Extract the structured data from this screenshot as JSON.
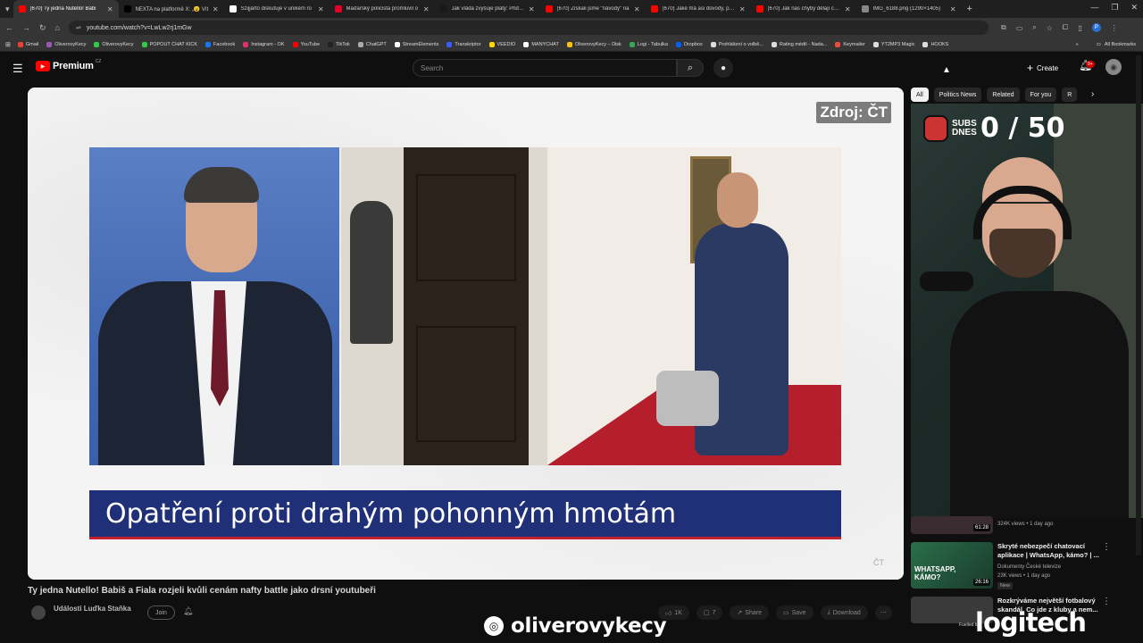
{
  "browser": {
    "tabs": [
      {
        "title": "(670) Ty jedna Nutello! Babi",
        "color": "#ff0000",
        "active": true
      },
      {
        "title": "NEXTA na platformě X: „😮 Vít",
        "color": "#000000",
        "active": false
      },
      {
        "title": "Szijjártó diskutuje v unikém ro",
        "color": "#ffffff",
        "active": false
      },
      {
        "title": "Maďarský policista promluvil o",
        "color": "#e4002b",
        "active": false
      },
      {
        "title": "Jak vláda zvyšuje platy: Přidá lé",
        "color": "#1a1a1a",
        "active": false
      },
      {
        "title": "(670) Získali jsme \"návody\" na",
        "color": "#ff0000",
        "active": false
      },
      {
        "title": "(670) Jaké má asi důvody, proč",
        "color": "#ff0000",
        "active": false
      },
      {
        "title": "(670) Jak nás chyby dělají chytř",
        "color": "#ff0000",
        "active": false
      },
      {
        "title": "IMG_6188.png (1290×1405)",
        "color": "#888888",
        "active": false
      }
    ],
    "url": "youtube.com/watch?v=LwLw2rj1mGw",
    "profile_initial": "P",
    "bookmarks": [
      {
        "label": "Gmail",
        "color": "#ea4335"
      },
      {
        "label": "OliverovyKecy",
        "color": "#9b59b6"
      },
      {
        "label": "OliverovyKecy",
        "color": "#2ecc40"
      },
      {
        "label": "POPOUT CHAT KICK",
        "color": "#2ecc40"
      },
      {
        "label": "Facebook",
        "color": "#1877f2"
      },
      {
        "label": "Instagram - OK",
        "color": "#e1306c"
      },
      {
        "label": "YouTube",
        "color": "#ff0000"
      },
      {
        "label": "TikTok",
        "color": "#222222"
      },
      {
        "label": "ChatGPT",
        "color": "#aaaaaa"
      },
      {
        "label": "StreamElements",
        "color": "#ffffff"
      },
      {
        "label": "Transkriptor",
        "color": "#3d5afe"
      },
      {
        "label": "VEEDIO",
        "color": "#ffd600"
      },
      {
        "label": "MANYCHAT",
        "color": "#ffffff"
      },
      {
        "label": "OliverovyKecy – Disk",
        "color": "#ffc107"
      },
      {
        "label": "Logi - Tabulka",
        "color": "#34a853"
      },
      {
        "label": "Dropbox",
        "color": "#0061ff"
      },
      {
        "label": "Prohlášení o volbě...",
        "color": "#dddddd"
      },
      {
        "label": "Rating médií - Nada...",
        "color": "#dddddd"
      },
      {
        "label": "Keymailer",
        "color": "#e74c3c"
      },
      {
        "label": "YT2MP3 Magic",
        "color": "#dddddd"
      },
      {
        "label": "HOOKS",
        "color": "#dddddd"
      }
    ],
    "all_bookmarks": "All Bookmarks"
  },
  "youtube": {
    "logo_text": "Premium",
    "country": "CZ",
    "search_placeholder": "Search",
    "create_label": "Create",
    "notif_badge": "9+",
    "filter_chips": [
      "All",
      "Politics News",
      "Related",
      "For you",
      "R"
    ],
    "video": {
      "source_tag": "Zdroj: ČT",
      "lower_third": "Opatření proti drahým pohonným hmotám",
      "title": "Ty jedna Nutello! Babiš a Fiala rozjeli kvůli cenám nafty battle jako drsní youtubeři",
      "channel": "Události Luďka Staňka",
      "join_label": "Join",
      "likes": "1K",
      "comments": "7",
      "share_label": "Share",
      "save_label": "Save",
      "download_label": "Download"
    },
    "stream_overlay": {
      "subs_label": "SUBS DNES",
      "subs_count": "0 / 50"
    },
    "related": [
      {
        "title": "",
        "meta": "324K views • 1 day ago",
        "duration": "61:28",
        "new": false
      },
      {
        "title": "Skryté nebezpečí chatovací aplikace | WhatsApp, kámo? | ...",
        "channel": "Dokumenty České televize",
        "meta": "23K views • 1 day ago",
        "duration": "26:16",
        "new": "New",
        "thumb_text": "WHATSAPP, KÁMO?"
      },
      {
        "title": "Rozkrýváme největší fotbalový skandál. Co jde z kluby a nem...",
        "meta": "",
        "duration": "",
        "new": false
      }
    ]
  },
  "watermark": {
    "handle": "oliverovykecy",
    "sponsor": "logitech",
    "sponsor_pre": "Fuelled by"
  },
  "colors": {
    "yt_red": "#ff0000",
    "ct_blue": "#1f2f78",
    "ct_red": "#c4202e",
    "bg": "#0f0f0f"
  }
}
